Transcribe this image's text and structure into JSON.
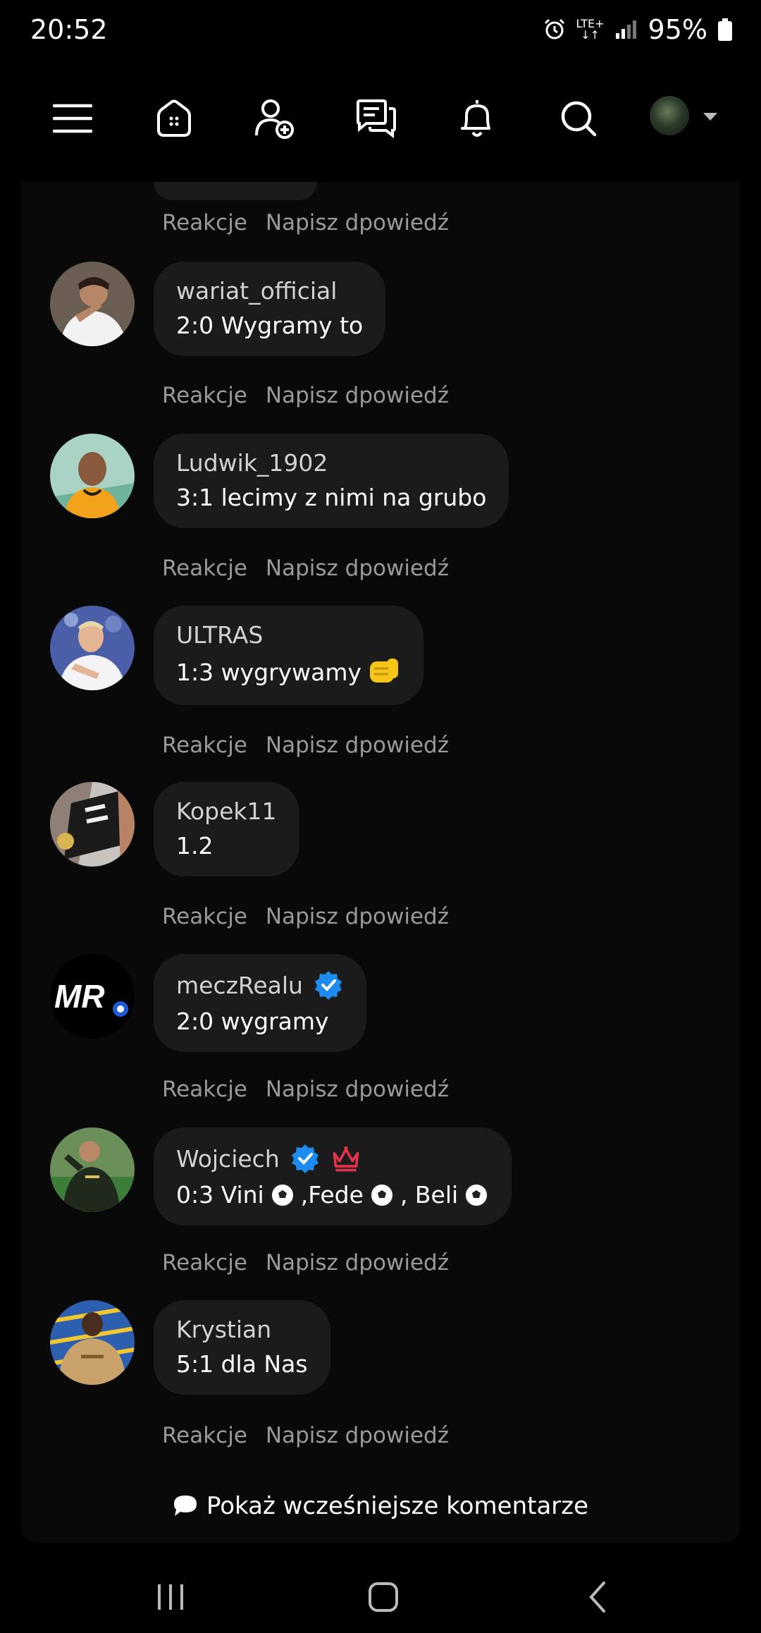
{
  "status_bar": {
    "time": "20:52",
    "network": "LTE+",
    "battery": "95%"
  },
  "nav": {
    "icons": [
      "menu-icon",
      "home-icon",
      "add-friend-icon",
      "messages-icon",
      "notifications-icon",
      "search-icon",
      "profile-avatar"
    ]
  },
  "actions": {
    "react": "Reakcje",
    "reply": "Napisz dpowiedź"
  },
  "comments": [
    {
      "user": "wariat_official",
      "text": "2:0 Wygramy to",
      "verified": false,
      "crown": false
    },
    {
      "user": "Ludwik_1902",
      "text": "3:1 lecimy z nimi na grubo",
      "verified": false,
      "crown": false
    },
    {
      "user": "ULTRAS",
      "text": "1:3 wygrywamy",
      "emoji": "fist-emoji",
      "verified": false,
      "crown": false
    },
    {
      "user": "Kopek11",
      "text": "1.2",
      "verified": false,
      "crown": false
    },
    {
      "user": "meczRealu",
      "text": "2:0 wygramy",
      "verified": true,
      "crown": false
    },
    {
      "user": "Wojciech",
      "text_parts": [
        "0:3 Vini ",
        ",Fede",
        ", Beli "
      ],
      "verified": true,
      "crown": true
    },
    {
      "user": "Krystian",
      "text": "5:1 dla Nas",
      "verified": false,
      "crown": false
    }
  ],
  "show_more": "Pokaż wcześniejsze komentarze",
  "colors": {
    "background": "#000000",
    "panel": "#090909",
    "bubble": "#1b1b1b",
    "muted": "#9a9a9a",
    "verified": "#1d8cf0",
    "crown": "#e0334c"
  }
}
